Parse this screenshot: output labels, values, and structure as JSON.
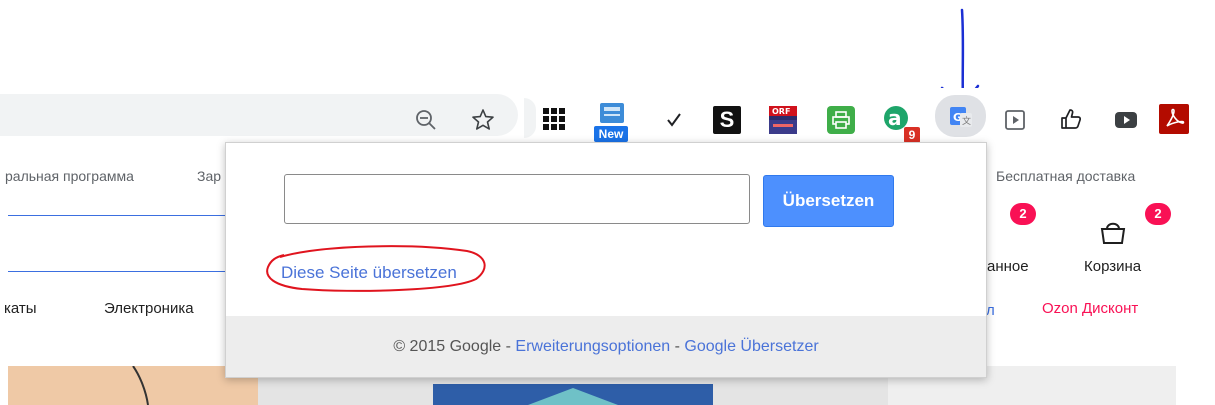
{
  "background_page": {
    "top_links": [
      "ральная программа",
      "Зар",
      "Бесплатная доставка"
    ],
    "nav_items": [
      "каты",
      "Электроника",
      "Ozon Дисконт"
    ],
    "favorites_label": "анное",
    "favorites_count": "2",
    "cart_label": "Корзина",
    "cart_count": "2"
  },
  "toolbar": {
    "extension_icons": [
      "zoom-out-icon",
      "star-icon",
      "grid-icon",
      "new-extension-icon",
      "checkmark-icon",
      "s-icon",
      "orf-icon",
      "printer-icon",
      "a-icon",
      "google-translate-icon",
      "play-icon",
      "thumbs-up-icon",
      "youtube-icon",
      "pdf-icon"
    ],
    "new_badge": "New",
    "a_badge": "9",
    "colors": {
      "accent_blue": "#1a73e8",
      "badge_red": "#d93025"
    }
  },
  "popup": {
    "input_value": "",
    "translate_button": "Übersetzen",
    "translate_page_link": "Diese Seite übersetzen",
    "footer": {
      "copyright": "© 2015 Google - ",
      "options_link": "Erweiterungsoptionen",
      "separator": " - ",
      "translator_link": "Google Übersetzer"
    }
  }
}
